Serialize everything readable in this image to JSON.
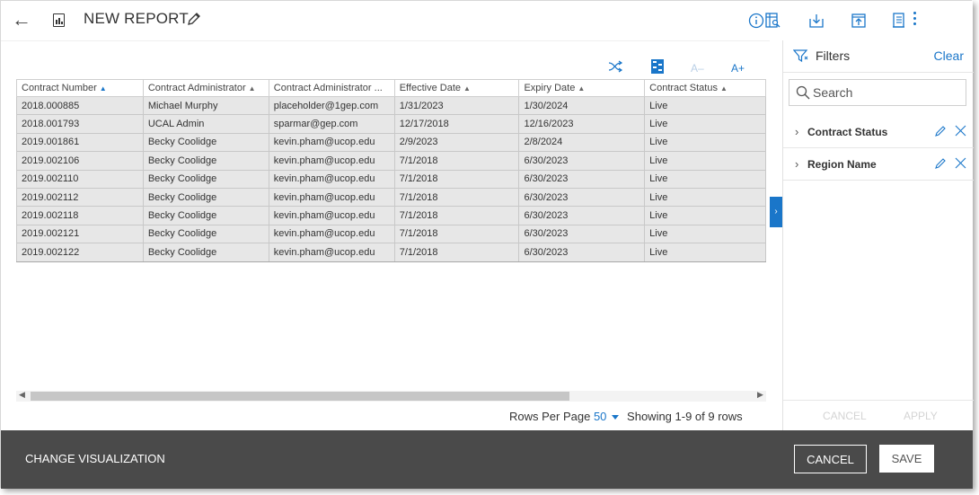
{
  "header": {
    "title": "NEW REPORT",
    "icons": [
      "back-arrow-icon",
      "report-icon",
      "pencil-icon",
      "info-icon",
      "preview-icon",
      "download-icon",
      "upload-icon",
      "document-icon",
      "more-vertical-icon"
    ]
  },
  "toolbar": {
    "font_decrease": "A–",
    "font_increase": "A+"
  },
  "table": {
    "columns": [
      "Contract Number",
      "Contract Administrator",
      "Contract Administrator ...",
      "Effective Date",
      "Expiry Date",
      "Contract Status"
    ],
    "rows": [
      [
        "2018.000885",
        "Michael Murphy",
        "placeholder@1gep.com",
        "1/31/2023",
        "1/30/2024",
        "Live"
      ],
      [
        "2018.001793",
        "UCAL Admin",
        "sparmar@gep.com",
        "12/17/2018",
        "12/16/2023",
        "Live"
      ],
      [
        "2019.001861",
        "Becky Coolidge",
        "kevin.pham@ucop.edu",
        "2/9/2023",
        "2/8/2024",
        "Live"
      ],
      [
        "2019.002106",
        "Becky Coolidge",
        "kevin.pham@ucop.edu",
        "7/1/2018",
        "6/30/2023",
        "Live"
      ],
      [
        "2019.002110",
        "Becky Coolidge",
        "kevin.pham@ucop.edu",
        "7/1/2018",
        "6/30/2023",
        "Live"
      ],
      [
        "2019.002112",
        "Becky Coolidge",
        "kevin.pham@ucop.edu",
        "7/1/2018",
        "6/30/2023",
        "Live"
      ],
      [
        "2019.002118",
        "Becky Coolidge",
        "kevin.pham@ucop.edu",
        "7/1/2018",
        "6/30/2023",
        "Live"
      ],
      [
        "2019.002121",
        "Becky Coolidge",
        "kevin.pham@ucop.edu",
        "7/1/2018",
        "6/30/2023",
        "Live"
      ],
      [
        "2019.002122",
        "Becky Coolidge",
        "kevin.pham@ucop.edu",
        "7/1/2018",
        "6/30/2023",
        "Live"
      ]
    ]
  },
  "pager": {
    "rows_per_page_label": "Rows Per Page",
    "rows_per_page_value": "50",
    "showing": "Showing 1-9 of 9 rows"
  },
  "filters": {
    "title": "Filters",
    "clear": "Clear",
    "search_placeholder": "Search",
    "items": [
      "Contract Status",
      "Region Name"
    ],
    "cancel": "CANCEL",
    "apply": "APPLY"
  },
  "bottom": {
    "change_visualization": "CHANGE VISUALIZATION",
    "cancel": "CANCEL",
    "save": "SAVE"
  },
  "colors": {
    "accent": "#1a76c9",
    "bottom_bar": "#4a4a4a",
    "row_bg": "#e7e7e7"
  }
}
